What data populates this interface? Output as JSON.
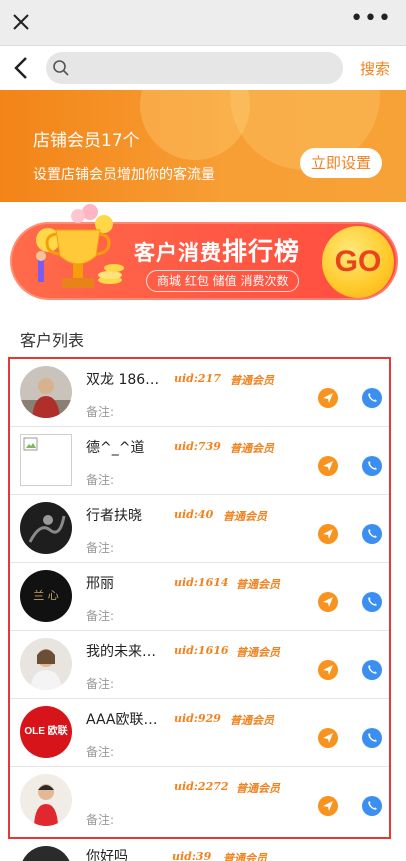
{
  "topbar": {
    "close_icon": "close-icon",
    "more_icon": "more-icon",
    "more_text": "•••"
  },
  "search": {
    "placeholder": "",
    "button_label": "搜索"
  },
  "banner": {
    "title": "店铺会员17个",
    "subtitle": "设置店铺会员增加你的客流量",
    "button_label": "立即设置"
  },
  "rank_banner": {
    "title_part1": "客户消费",
    "title_part2": "排行榜",
    "tags": "商城  红包  储值  消费次数",
    "go_label": "GO"
  },
  "section_title": "客户列表",
  "customers": [
    {
      "name": "双龙 1860…",
      "uid": "uid:217",
      "level": "普通会员",
      "remark": "备注:"
    },
    {
      "name": "德^_^道",
      "uid": "uid:739",
      "level": "普通会员",
      "remark": "备注:"
    },
    {
      "name": "行者扶晓",
      "uid": "uid:40",
      "level": "普通会员",
      "remark": "备注:"
    },
    {
      "name": "邢丽",
      "uid": "uid:1614",
      "level": "普通会员",
      "remark": "备注:"
    },
    {
      "name": "我的未来…",
      "uid": "uid:1616",
      "level": "普通会员",
      "remark": "备注:"
    },
    {
      "name": "AAA欧联…",
      "uid": "uid:929",
      "level": "普通会员",
      "remark": "备注:"
    },
    {
      "name": "",
      "uid": "uid:2272",
      "level": "普通会员",
      "remark": "备注:"
    }
  ],
  "peek_row": {
    "name": "你好吗",
    "uid": "uid:39",
    "level": "普通会员"
  },
  "avatar_texts": {
    "row4": "兰 心",
    "row6": "OLE 欧联"
  },
  "colors": {
    "accent": "#f0821f",
    "banner": "#f38418",
    "highlight_border": "#e53935",
    "send": "#f7931e",
    "call": "#3b8ff0"
  }
}
